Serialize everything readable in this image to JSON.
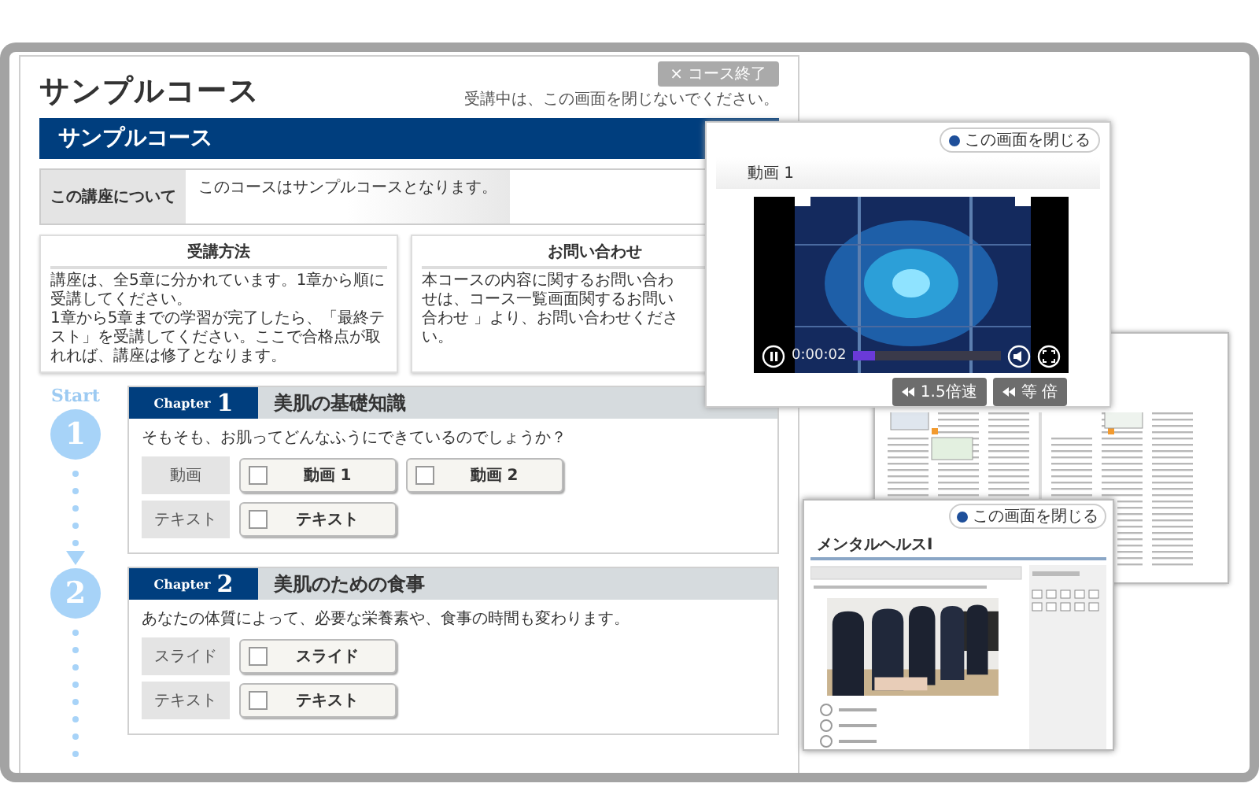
{
  "course": {
    "title": "サンプルコース",
    "exit_button": {
      "icon": "×",
      "label": "コース終了"
    },
    "notice": "受講中は、この画面を閉じないでください。",
    "banner": "サンプルコース",
    "about": {
      "label": "この講座について",
      "text": "このコースはサンプルコースとなります。"
    },
    "info_boxes": [
      {
        "title": "受講方法",
        "text": "講座は、全5章に分かれています。1章から順に受講してください。\n1章から5章までの学習が完了したら、「最終テスト」を受講してください。ここで合格点が取れれば、講座は修了となります。"
      },
      {
        "title": "お問い合わせ",
        "text": "本コースの内容に関するお問い合わせは、コース一覧画面関するお問い合わせ 」より、お問い合わせください。"
      }
    ],
    "start_label": "Start",
    "chapters": [
      {
        "step_number": "1",
        "chapter_word": "Chapter",
        "number": "1",
        "title": "美肌の基礎知識",
        "description": "そもそも、お肌ってどんなふうにできているのでしょうか？",
        "rows": [
          {
            "label": "動画",
            "items": [
              {
                "label": "動画 1",
                "checked": false
              },
              {
                "label": "動画 2",
                "checked": false
              }
            ]
          },
          {
            "label": "テキスト",
            "items": [
              {
                "label": "テキスト",
                "checked": false
              }
            ]
          }
        ]
      },
      {
        "step_number": "2",
        "chapter_word": "Chapter",
        "number": "2",
        "title": "美肌のための食事",
        "description": "あなたの体質によって、必要な栄養素や、食事の時間も変わります。",
        "rows": [
          {
            "label": "スライド",
            "items": [
              {
                "label": "スライド",
                "checked": false
              }
            ]
          },
          {
            "label": "テキスト",
            "items": [
              {
                "label": "テキスト",
                "checked": false
              }
            ]
          }
        ]
      }
    ]
  },
  "video_window": {
    "close_button": "この画面を閉じる",
    "title": "動画 1",
    "time": "0:00:02",
    "playing": true,
    "level": 0.15,
    "speed_buttons": [
      "1.5倍速",
      "等 倍"
    ]
  },
  "quiz_window": {
    "close_button": "この画面を閉じる",
    "title": "メンタルヘルスⅠ",
    "options": [
      {
        "selected": false
      },
      {
        "selected": false
      },
      {
        "selected": false
      }
    ]
  }
}
